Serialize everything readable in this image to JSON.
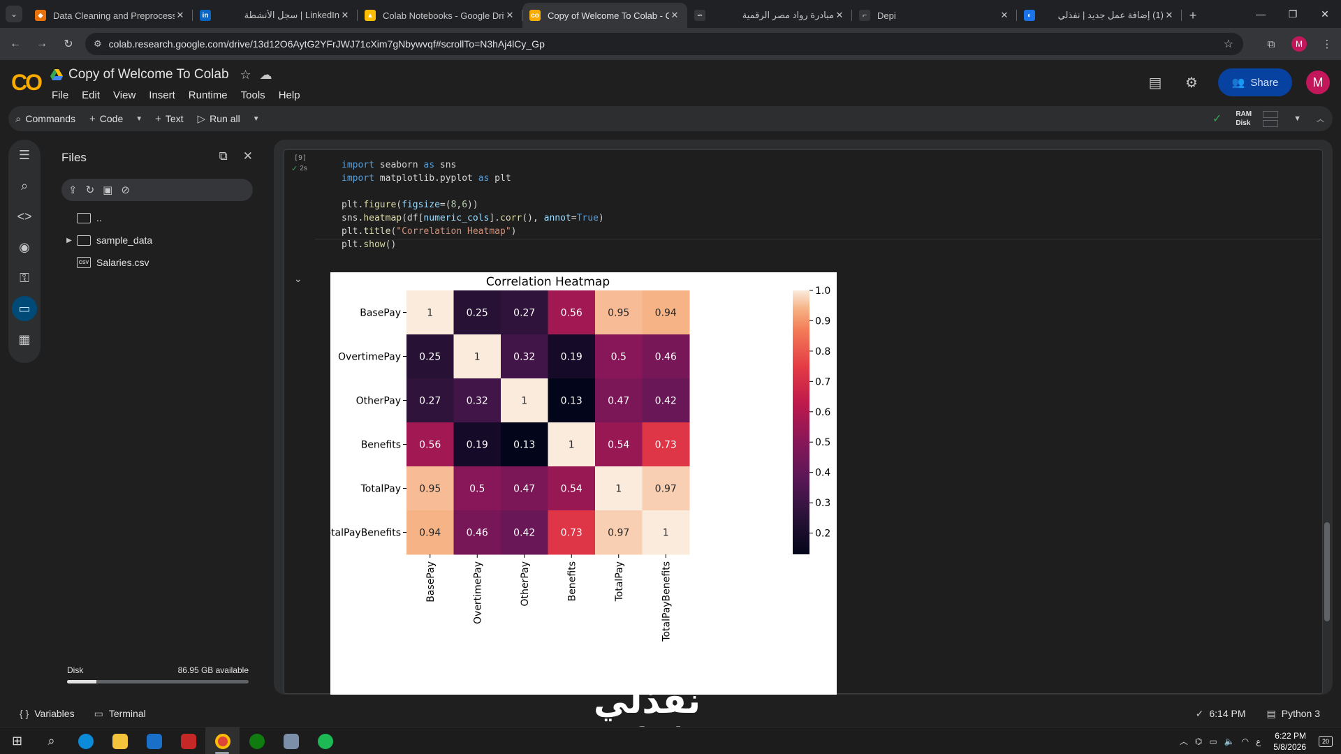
{
  "browser": {
    "tabs": [
      {
        "title": "Data Cleaning and Preprocessin",
        "fav_color": "#e8710a",
        "fav_glyph": "◆",
        "active": false,
        "rtl": false
      },
      {
        "title": "LinkedIn | سجل الأنشطة",
        "fav_color": "#0a66c2",
        "fav_glyph": "in",
        "active": false,
        "rtl": true
      },
      {
        "title": "Colab Notebooks - Google Driv",
        "fav_color": "#fbbc04",
        "fav_glyph": "▲",
        "active": false,
        "rtl": false
      },
      {
        "title": "Copy of Welcome To Colab - Co",
        "fav_color": "#f9ab00",
        "fav_glyph": "co",
        "active": true,
        "rtl": false
      },
      {
        "title": "مبادرة رواد مصر الرقمية",
        "fav_color": "#35363a",
        "fav_glyph": "∽",
        "active": false,
        "rtl": true
      },
      {
        "title": "Depi",
        "fav_color": "#35363a",
        "fav_glyph": "⌐",
        "active": false,
        "rtl": false
      },
      {
        "title": "(1) إضافة عمل جديد | نفذلي",
        "fav_color": "#1a73e8",
        "fav_glyph": "◐",
        "active": false,
        "rtl": true
      }
    ],
    "url": "colab.research.google.com/drive/13d12O6AytG2YFrJWJ71cXim7gNbywvqf#scrollTo=N3hAj4lCy_Gp",
    "avatar_letter": "M"
  },
  "colab": {
    "doc_title": "Copy of Welcome To Colab",
    "menu": [
      "File",
      "Edit",
      "View",
      "Insert",
      "Runtime",
      "Tools",
      "Help"
    ],
    "share_label": "Share",
    "avatar_letter": "M",
    "commands": {
      "commands_label": "Commands",
      "code_label": "Code",
      "text_label": "Text",
      "run_all_label": "Run all"
    },
    "ram_label": "RAM",
    "disk_label": "Disk"
  },
  "files": {
    "title": "Files",
    "items": [
      {
        "name": "..",
        "type": "folder",
        "expandable": false
      },
      {
        "name": "sample_data",
        "type": "folder",
        "expandable": true
      },
      {
        "name": "Salaries.csv",
        "type": "csv",
        "expandable": false
      }
    ],
    "disk_label": "Disk",
    "disk_available": "86.95 GB available",
    "disk_used_fraction": 0.16
  },
  "cell": {
    "exec_count": "[9]",
    "exec_time": "2s",
    "code_lines": [
      "import seaborn as sns",
      "import matplotlib.pyplot as plt",
      "",
      "plt.figure(figsize=(8,6))",
      "sns.heatmap(df[numeric_cols].corr(), annot=True)",
      "plt.title(\"Correlation Heatmap\")",
      "plt.show()"
    ]
  },
  "chart_data": {
    "type": "heatmap",
    "title": "Correlation Heatmap",
    "xlabel": "",
    "ylabel": "",
    "labels": [
      "BasePay",
      "OvertimePay",
      "OtherPay",
      "Benefits",
      "TotalPay",
      "TotalPayBenefits"
    ],
    "matrix": [
      [
        1,
        0.25,
        0.27,
        0.56,
        0.95,
        0.94
      ],
      [
        0.25,
        1,
        0.32,
        0.19,
        0.5,
        0.46
      ],
      [
        0.27,
        0.32,
        1,
        0.13,
        0.47,
        0.42
      ],
      [
        0.56,
        0.19,
        0.13,
        1,
        0.54,
        0.73
      ],
      [
        0.95,
        0.5,
        0.47,
        0.54,
        1,
        0.97
      ],
      [
        0.94,
        0.46,
        0.42,
        0.73,
        0.97,
        1
      ]
    ],
    "colorbar_ticks": [
      0.2,
      0.3,
      0.4,
      0.5,
      0.6,
      0.7,
      0.8,
      0.9,
      1.0
    ],
    "colorbar_range": [
      0.13,
      1.0
    ],
    "colormap": "rocket"
  },
  "statusbar": {
    "variables_label": "Variables",
    "terminal_label": "Terminal",
    "saved_time": "6:14 PM",
    "runtime_label": "Python 3"
  },
  "watermark": {
    "arabic": "نفذلي",
    "latin": "nafezly.com"
  },
  "taskbar": {
    "time": "6:22 PM",
    "date": "5/8/2026",
    "notifications": "20"
  }
}
